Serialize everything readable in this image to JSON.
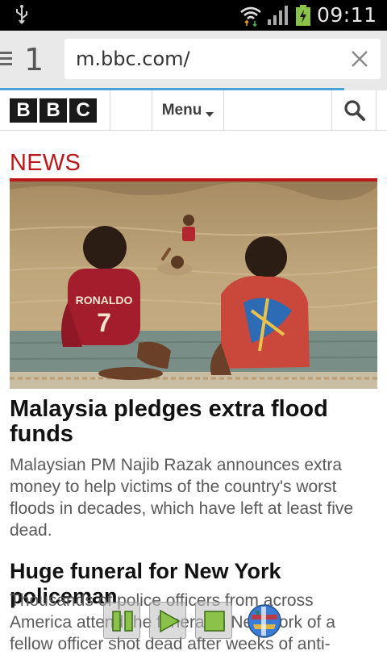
{
  "status_bar": {
    "time": "09:11",
    "icons": [
      "usb-icon",
      "wifi-icon",
      "signal-icon",
      "battery-charging-icon"
    ]
  },
  "browser": {
    "tab_count": "1",
    "url": "m.bbc.com/",
    "progress": 0.89,
    "accent_color": "#4aa3d6"
  },
  "site_nav": {
    "logo_letters": [
      "B",
      "B",
      "C"
    ],
    "menu_label": "Menu",
    "search_icon": "search-icon"
  },
  "section": {
    "title": "NEWS",
    "color": "#bb1919"
  },
  "articles": [
    {
      "headline": "Malaysia pledges extra flood funds",
      "summary": "Malaysian PM Najib Razak announces extra money to help victims of the country's worst floods in decades, which have left at least five dead."
    },
    {
      "headline": "Huge funeral for New York policeman",
      "summary": "Thousands of police officers from across America attend the funeral in New York of a fellow officer shot dead after weeks of anti-"
    }
  ],
  "hero_image": {
    "jersey_text": "RONALDO",
    "jersey_number": "7"
  },
  "media_controls": [
    "pause-icon",
    "play-icon",
    "stop-icon",
    "globe-icon"
  ]
}
